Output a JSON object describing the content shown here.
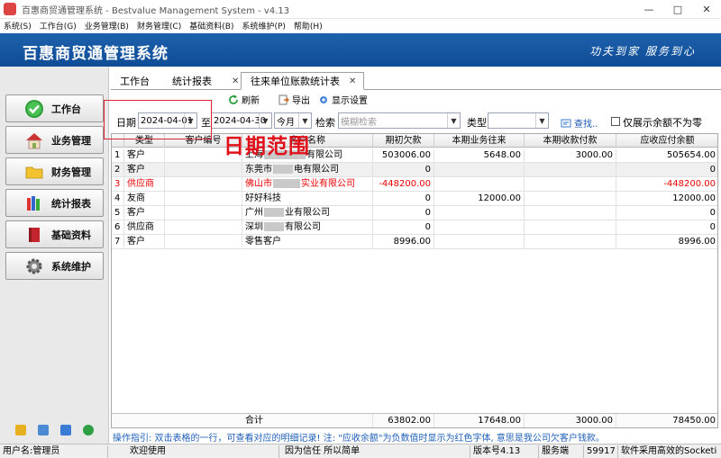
{
  "window": {
    "title": "百惠商贸通管理系统 - Bestvalue Management System - v4.13"
  },
  "menu": [
    "系统(S)",
    "工作台(G)",
    "业务管理(B)",
    "财务管理(C)",
    "基础资料(B)",
    "系统维护(P)",
    "帮助(H)"
  ],
  "banner": {
    "brand": "百惠商贸通管理系统",
    "slogan": "功夫到家  服务到心"
  },
  "sidebar": {
    "items": [
      "工作台",
      "业务管理",
      "财务管理",
      "统计报表",
      "基础资料",
      "系统维护"
    ]
  },
  "tabs": [
    {
      "label": "工作台"
    },
    {
      "label": "统计报表"
    },
    {
      "label": "往来单位账款统计表"
    }
  ],
  "toolbar": {
    "refresh": "刷新",
    "export": "导出",
    "display": "显示设置"
  },
  "filters": {
    "date_label": "日期",
    "from": "2024-04-01",
    "to_label": "至",
    "to": "2024-04-30",
    "period": "今月",
    "search_label": "检索",
    "search_placeholder": "模糊检索",
    "type_label": "类型",
    "find": "查找..",
    "nonzero_label": "仅展示余额不为零"
  },
  "table": {
    "columns": [
      "类型",
      "客户编号",
      "客户名称",
      "期初欠款",
      "本期业务往来",
      "本期收款付款",
      "应收应付余额"
    ],
    "rows": [
      {
        "no": "1",
        "type": "客户",
        "code": "",
        "name_a": "上海",
        "name_b": "有限公司",
        "opening": "503006.00",
        "business": "5648.00",
        "payment": "3000.00",
        "balance": "505654.00"
      },
      {
        "no": "2",
        "type": "客户",
        "code": "",
        "name_a": "东莞市",
        "name_b": "电有限公司",
        "opening": "0",
        "business": "",
        "payment": "",
        "balance": "0"
      },
      {
        "no": "3",
        "type": "供应商",
        "code": "",
        "name_a": "佛山市",
        "name_b": "实业有限公司",
        "opening": "-448200.00",
        "business": "",
        "payment": "",
        "balance": "-448200.00"
      },
      {
        "no": "4",
        "type": "友商",
        "code": "",
        "name_a": "好好科技",
        "name_b": "",
        "opening": "0",
        "business": "12000.00",
        "payment": "",
        "balance": "12000.00"
      },
      {
        "no": "5",
        "type": "客户",
        "code": "",
        "name_a": "广州",
        "name_b": "业有限公司",
        "opening": "0",
        "business": "",
        "payment": "",
        "balance": "0"
      },
      {
        "no": "6",
        "type": "供应商",
        "code": "",
        "name_a": "深圳",
        "name_b": "有限公司",
        "opening": "0",
        "business": "",
        "payment": "",
        "balance": "0"
      },
      {
        "no": "7",
        "type": "客户",
        "code": "",
        "name_a": "零售客户",
        "name_b": "",
        "opening": "8996.00",
        "business": "",
        "payment": "",
        "balance": "8996.00"
      }
    ],
    "footer": {
      "label": "合计",
      "opening": "63802.00",
      "business": "17648.00",
      "payment": "3000.00",
      "balance": "78450.00"
    }
  },
  "hint": "操作指引: 双击表格的一行，可查看对应的明细记录! 注: \"应收余额\"为负数值时显示为红色字体, 意思是我公司欠客户钱款。",
  "status": {
    "user": "用户名:管理员",
    "welcome": "欢迎使用",
    "motto": "因为信任 所以简单",
    "version": "版本号4.13",
    "service_label": "服务端",
    "port": "59917",
    "tech": "软件采用高效的Socketi"
  },
  "annotation": "日期范围",
  "colors": {
    "banner": "#1d61ad",
    "negative": "#e00000",
    "annotation": "#e0101a",
    "hint": "#1f5fb8"
  }
}
